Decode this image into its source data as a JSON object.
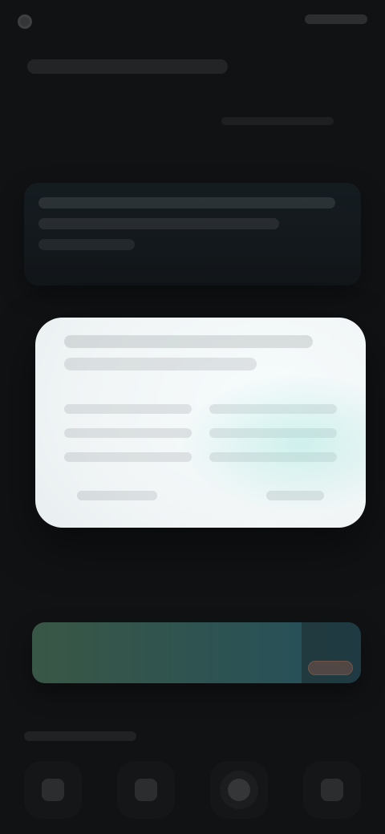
{
  "status_bar": {
    "left_icon": "status-dot-icon",
    "right_icons": [
      "network-icon",
      "battery-icon"
    ]
  },
  "header": {
    "title": "",
    "subtitle": ""
  },
  "message": {
    "lines": [
      "",
      "",
      ""
    ]
  },
  "card": {
    "title_lines": [
      "",
      ""
    ],
    "fields": [
      "",
      "",
      "",
      "",
      "",
      ""
    ],
    "footer": [
      "",
      ""
    ]
  },
  "cta": {
    "label": "",
    "progress": 0.82,
    "badge": ""
  },
  "bottom": {
    "section_label": "",
    "nav_items": [
      {
        "label": "",
        "icon": "home-icon"
      },
      {
        "label": "",
        "icon": "list-icon"
      },
      {
        "label": "",
        "icon": "circle-icon"
      },
      {
        "label": "",
        "icon": "menu-icon"
      }
    ]
  }
}
